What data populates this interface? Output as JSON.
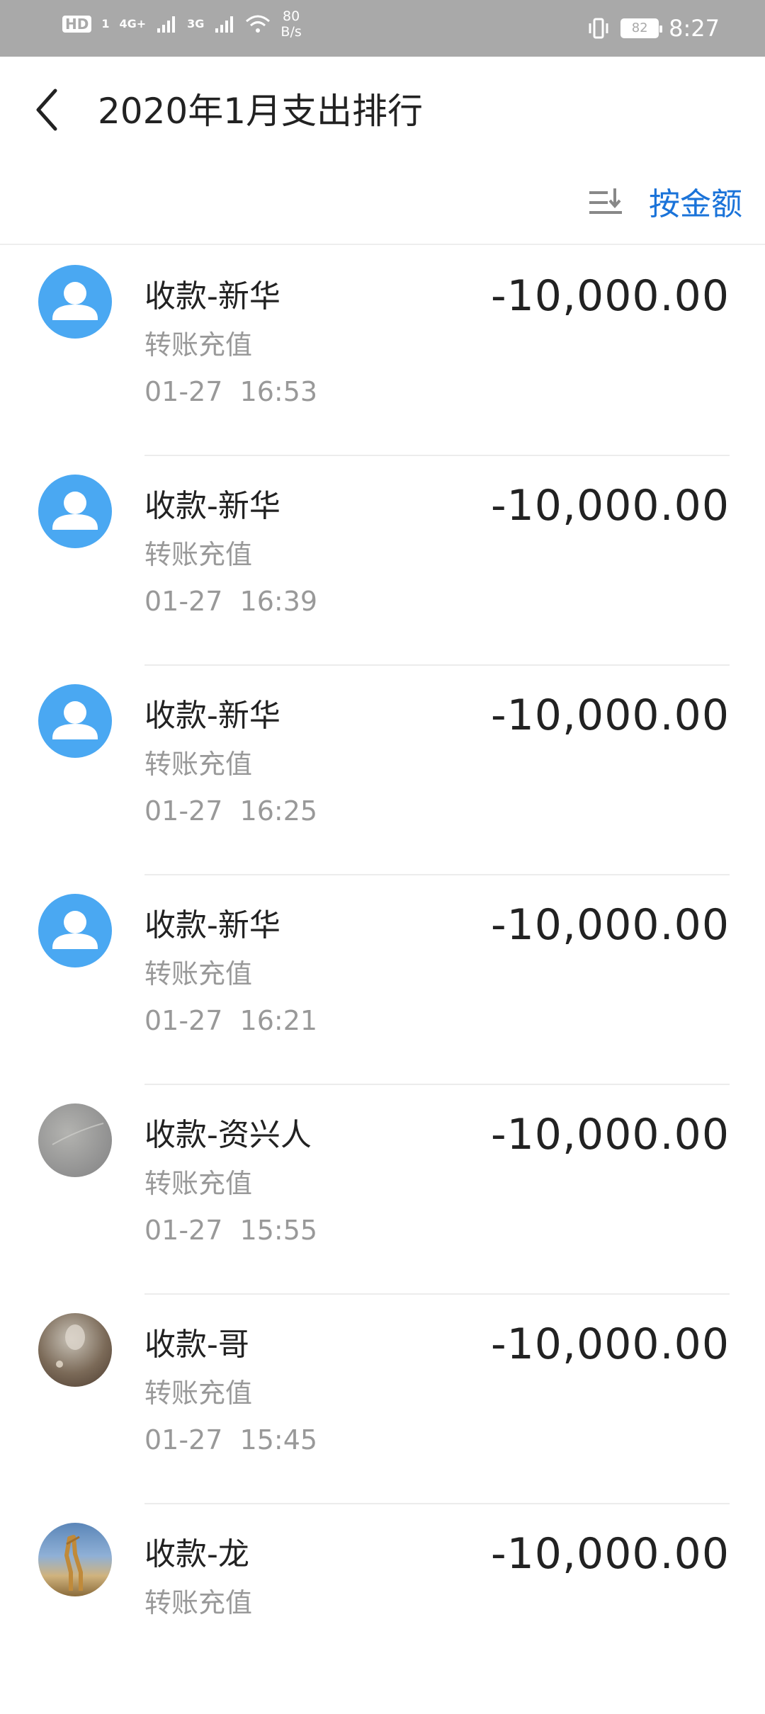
{
  "status_bar": {
    "hd": "HD",
    "sim1": "1",
    "net1": "4G+",
    "net2": "3G",
    "speed_value": "80",
    "speed_unit": "B/s",
    "battery": "82",
    "time": "8:27"
  },
  "header": {
    "title": "2020年1月支出排行"
  },
  "sort": {
    "label": "按金额"
  },
  "items": [
    {
      "name": "收款-新华",
      "category": "转账充值",
      "datetime": "01-27  16:53",
      "amount": "-10,000.00"
    },
    {
      "name": "收款-新华",
      "category": "转账充值",
      "datetime": "01-27  16:39",
      "amount": "-10,000.00"
    },
    {
      "name": "收款-新华",
      "category": "转账充值",
      "datetime": "01-27  16:25",
      "amount": "-10,000.00"
    },
    {
      "name": "收款-新华",
      "category": "转账充值",
      "datetime": "01-27  16:21",
      "amount": "-10,000.00"
    },
    {
      "name": "收款-资兴人",
      "category": "转账充值",
      "datetime": "01-27  15:55",
      "amount": "-10,000.00"
    },
    {
      "name": "收款-哥",
      "category": "转账充值",
      "datetime": "01-27  15:45",
      "amount": "-10,000.00"
    },
    {
      "name": "收款-龙",
      "category": "转账充值",
      "datetime": "",
      "amount": "-10,000.00"
    }
  ],
  "colors": {
    "accent": "#1a73d9",
    "default_avatar": "#4aa8f2",
    "status_bar": "#a9a9a9"
  }
}
